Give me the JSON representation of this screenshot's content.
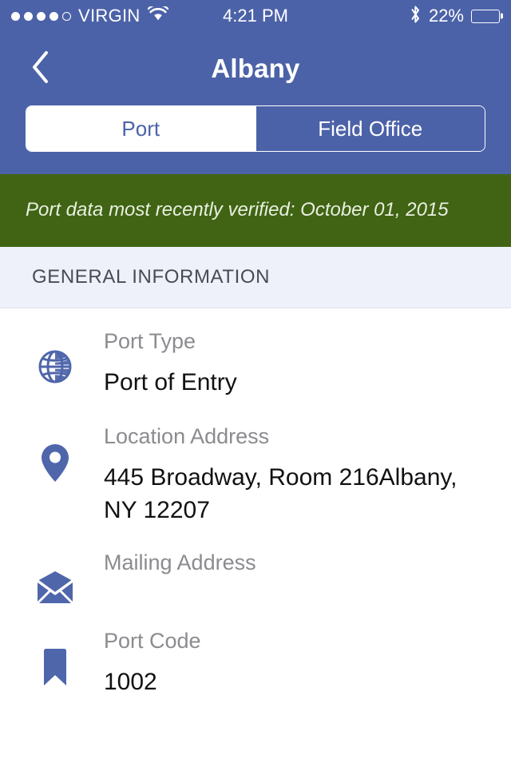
{
  "status_bar": {
    "signal_dots_filled": 4,
    "signal_dots_total": 5,
    "carrier": "VIRGIN",
    "wifi_icon": "wifi-icon",
    "time": "4:21 PM",
    "bluetooth_icon": "bluetooth-icon",
    "battery_percent": "22%",
    "battery_level": 22
  },
  "nav": {
    "back_icon": "chevron-left-icon",
    "title": "Albany"
  },
  "segmented_control": {
    "options": [
      {
        "label": "Port",
        "selected": true
      },
      {
        "label": "Field Office",
        "selected": false
      }
    ],
    "selected_index": 0
  },
  "banner": {
    "text": "Port data most recently verified: October 01, 2015",
    "background_color": "#406414",
    "text_color": "#e9efe0"
  },
  "section": {
    "title": "GENERAL INFORMATION",
    "background_color": "#eef1fa"
  },
  "info_rows": [
    {
      "icon": "globe-icon",
      "label": "Port Type",
      "value": "Port of Entry"
    },
    {
      "icon": "map-pin-icon",
      "label": "Location Address",
      "value": "445 Broadway, Room 216Albany, NY 12207"
    },
    {
      "icon": "envelope-icon",
      "label": "Mailing Address",
      "value": ""
    },
    {
      "icon": "bookmark-icon",
      "label": "Port Code",
      "value": "1002"
    }
  ],
  "theme": {
    "header_blue": "#4c62a8",
    "icon_blue": "#4f66ab",
    "label_gray": "#8b8b90",
    "value_black": "#111114"
  }
}
